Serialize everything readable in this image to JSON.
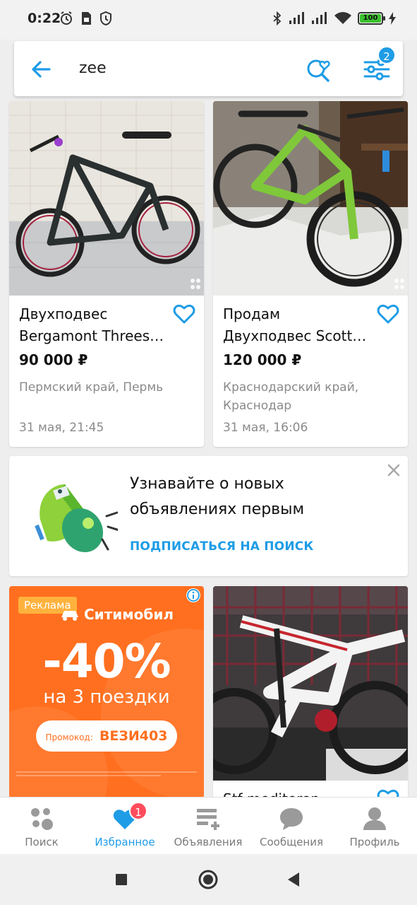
{
  "status_bar": {
    "time": "0:22",
    "battery": "100"
  },
  "search": {
    "query": "zee",
    "filter_count": "2"
  },
  "listings": [
    {
      "title_line1": "Двухподвес",
      "title_line2": "Bergamont Threes…",
      "price": "90 000 ₽",
      "location": "Пермский край, Пермь",
      "date": "31 мая, 21:45"
    },
    {
      "title_line1": "Продам",
      "title_line2": "Двухподвес Scott…",
      "price": "120 000 ₽",
      "location": "Краснодарский край, Краснодар",
      "date": "31 мая, 16:06"
    },
    {
      "title_line1": "Stf mediteren",
      "title_line2": ""
    }
  ],
  "subscribe": {
    "text": "Узнавайте о новых объявлениях первым",
    "link": "ПОДПИСАТЬСЯ НА ПОИСК"
  },
  "ad": {
    "label": "Реклама",
    "brand": "Ситимобил",
    "discount": "-40%",
    "subtitle": "на 3 поездки",
    "promo_label": "Промокод:",
    "promo_code": "ВЕЗИ403"
  },
  "bottom_nav": [
    {
      "label": "Поиск",
      "icon": "search-dots-icon"
    },
    {
      "label": "Избранное",
      "icon": "heart-icon",
      "badge": "1"
    },
    {
      "label": "Объявления",
      "icon": "add-listing-icon"
    },
    {
      "label": "Сообщения",
      "icon": "chat-icon"
    },
    {
      "label": "Профиль",
      "icon": "profile-icon"
    }
  ],
  "colors": {
    "accent": "#1e9ce6",
    "ad_orange": "#ff6f1f",
    "badge_red": "#ff4d5e"
  }
}
